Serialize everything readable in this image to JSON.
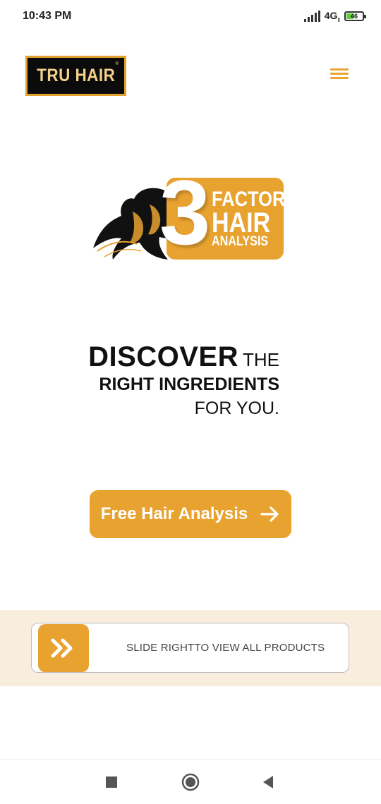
{
  "status_bar": {
    "time": "10:43 PM",
    "network": "4G",
    "network_sub": "ll",
    "battery": "46",
    "battery_level": 0.46
  },
  "header": {
    "logo_text": "TRU HAIR",
    "logo_mark": "®",
    "menu_icon": "hamburger-menu-icon"
  },
  "hero": {
    "number": "3",
    "line1": "FACTOR",
    "line2": "HAIR",
    "line3": "ANALYSIS",
    "illustration": "hair-silhouette-icon"
  },
  "tagline": {
    "word1": "DISCOVER",
    "word2": "THE",
    "line2": "RIGHT INGREDIENTS",
    "line3": "FOR YOU."
  },
  "cta": {
    "label": "Free Hair Analysis",
    "icon": "arrow-right-icon"
  },
  "slider": {
    "label": "SLIDE RIGHTTO VIEW ALL PRODUCTS",
    "icon": "double-chevron-right-icon"
  },
  "nav_bar": {
    "recent_icon": "square-icon",
    "home_icon": "circle-icon",
    "back_icon": "triangle-back-icon"
  },
  "colors": {
    "accent": "#e8a230",
    "band": "#f9eedd",
    "logo_bg": "#0b0b0b",
    "logo_text": "#f4d28b"
  }
}
